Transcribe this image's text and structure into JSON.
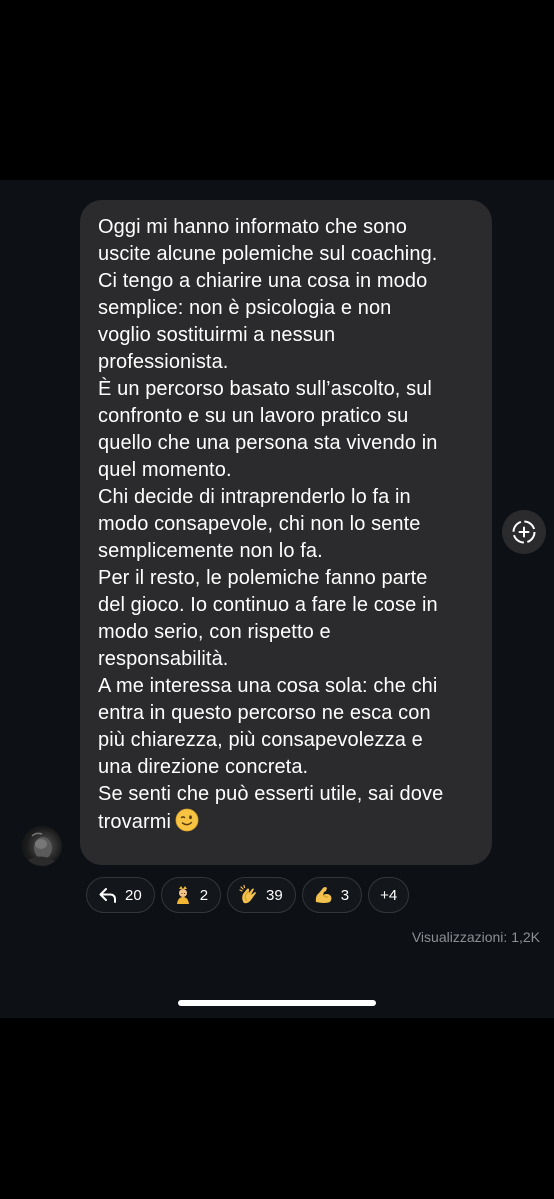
{
  "message": {
    "paragraphs": [
      "Oggi mi hanno informato che sono\nuscite alcune polemiche sul coaching.",
      "Ci tengo a chiarire una cosa in modo\nsemplice: non è psicologia e non\nvoglio sostituirmi a nessun\nprofessionista.",
      "È un percorso basato sull’ascolto, sul\nconfronto e su un lavoro pratico su\nquello che una persona sta vivendo in\nquel momento.",
      "Chi decide di intraprenderlo lo fa in\nmodo consapevole, chi non lo sente\nsemplicemente non lo fa.",
      "Per il resto, le polemiche fanno parte\ndel gioco. Io continuo a fare le cose in\nmodo serio, con rispetto e\nresponsabilità.",
      "A me interessa una cosa sola: che chi\nentra in questo percorso ne esca con\npiù chiarezza, più consapevolezza e\nuna direzione concreta.",
      "Se senti che può esserti utile, sai dove\ntrovarmi"
    ],
    "trailing_emoji": "winking-face-emoji"
  },
  "reactions": [
    {
      "icon": "reply-arrow-icon",
      "count": "20"
    },
    {
      "icon": "genie-emoji",
      "count": "2"
    },
    {
      "icon": "clapping-hands-emoji",
      "count": "39"
    },
    {
      "icon": "flexed-biceps-emoji",
      "count": "3"
    }
  ],
  "more_reactions": "+4",
  "views": "Visualizzazioni: 1,2K",
  "share_icon": "add-circle-icon",
  "colors": {
    "background": "#0d1116",
    "bubble": "#2b2b2e",
    "chip_border": "#34363b",
    "muted_text": "#8b8f96"
  }
}
